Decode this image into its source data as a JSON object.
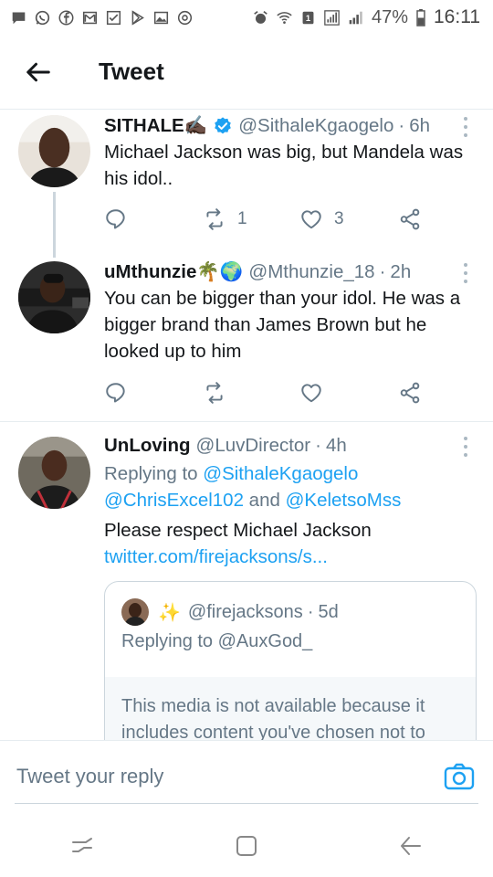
{
  "status_bar": {
    "battery": "47%",
    "time": "16:11",
    "sim_badge": "1",
    "left_icons": [
      "message-icon",
      "whatsapp-icon",
      "facebook-icon",
      "gmail-icon",
      "checkbox-icon",
      "play-store-icon",
      "gallery-icon",
      "settings-dial-icon"
    ],
    "right_icons": [
      "alarm-icon",
      "wifi-icon",
      "sim-icon",
      "signal-icon",
      "signal-icon-2",
      "battery-icon"
    ]
  },
  "header": {
    "title": "Tweet",
    "back_icon": "arrow-left-icon"
  },
  "tweets": [
    {
      "name": "SITHALE✍🏿",
      "verified": true,
      "handle": "@SithaleKgaogelo",
      "time": "6h",
      "text": "Michael Jackson was big, but Mandela was his idol..",
      "retweets": "1",
      "likes": "3"
    },
    {
      "name": "uMthunzie🌴🌍",
      "verified": false,
      "handle": "@Mthunzie_18",
      "time": "2h",
      "text": "You can be bigger than your idol. He was a bigger brand than James Brown but he looked up to him",
      "retweets": "",
      "likes": ""
    },
    {
      "name": "UnLoving",
      "verified": false,
      "handle": "@LuvDirector",
      "time": "4h",
      "replying_prefix": "Replying to ",
      "replying_user_1": "@SithaleKgaogelo",
      "replying_user_2": "@ChrisExcel102",
      "replying_and": " and ",
      "replying_user_3": "@KeletsoMss",
      "text": "Please respect Michael Jackson",
      "link": "twitter.com/firejacksons/s..."
    }
  ],
  "quoted_tweet": {
    "sparkle": "✨",
    "handle": "@firejacksons",
    "time": "5d",
    "replying": "Replying to @AuxGod_",
    "notice": "This media is not available because it includes content you've chosen not to"
  },
  "reply_bar": {
    "placeholder": "Tweet your reply",
    "camera_icon": "camera-icon"
  },
  "nav_bar": {
    "icons": [
      "recent-apps-icon",
      "home-icon",
      "back-icon"
    ]
  },
  "colors": {
    "accent": "#1da1f2",
    "secondary_text": "#657786",
    "border": "#e6ecf0"
  }
}
